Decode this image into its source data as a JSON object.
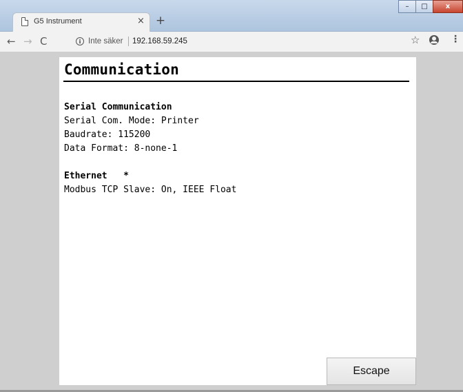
{
  "browser": {
    "tab_title": "G5 Instrument",
    "tab_close": "×",
    "new_tab": "+",
    "security_label": "Inte säker",
    "url": "192.168.59.245",
    "icons": {
      "back": "back-arrow-icon",
      "forward": "forward-arrow-icon",
      "reload": "reload-icon",
      "info": "info-icon",
      "bookmark": "star-icon",
      "account": "account-icon",
      "menu": "kebab-menu-icon"
    },
    "window_controls": {
      "minimize": "–",
      "maximize": "□",
      "close": "x"
    }
  },
  "page": {
    "title": "Communication",
    "serial": {
      "heading": "Serial Communication",
      "mode": "Serial Com. Mode: Printer",
      "baudrate": "Baudrate: 115200",
      "data_format": "Data Format: 8-none-1"
    },
    "ethernet": {
      "heading": "Ethernet   *",
      "modbus": "Modbus TCP Slave: On, IEEE Float"
    },
    "escape_label": "Escape"
  }
}
